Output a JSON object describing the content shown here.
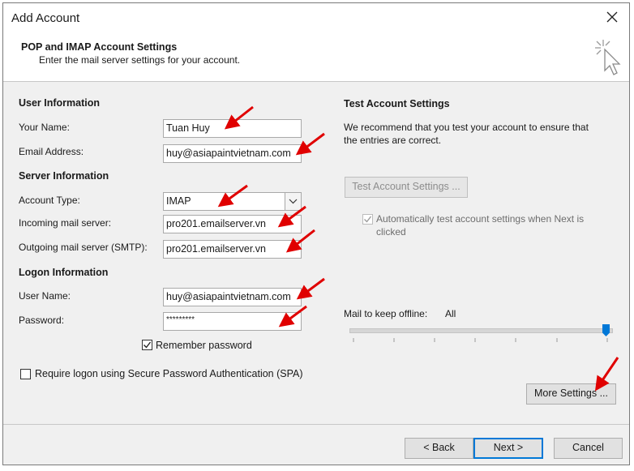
{
  "window": {
    "title": "Add Account"
  },
  "header": {
    "title": "POP and IMAP Account Settings",
    "subtitle": "Enter the mail server settings for your account."
  },
  "user_info": {
    "heading": "User Information",
    "name_label": "Your Name:",
    "name_value": "Tuan Huy",
    "email_label": "Email Address:",
    "email_value": "huy@asiapaintvietnam.com"
  },
  "server_info": {
    "heading": "Server Information",
    "type_label": "Account Type:",
    "type_value": "IMAP",
    "incoming_label": "Incoming mail server:",
    "incoming_value": "pro201.emailserver.vn",
    "outgoing_label": "Outgoing mail server (SMTP):",
    "outgoing_value": "pro201.emailserver.vn"
  },
  "logon_info": {
    "heading": "Logon Information",
    "user_label": "User Name:",
    "user_value": "huy@asiapaintvietnam.com",
    "password_label": "Password:",
    "password_value": "*********",
    "remember_label": "Remember password",
    "remember_checked": true,
    "spa_label": "Require logon using Secure Password Authentication (SPA)",
    "spa_checked": false
  },
  "test_settings": {
    "heading": "Test Account Settings",
    "description_line1": "We recommend that you test your account to ensure that",
    "description_line2": "the entries are correct.",
    "test_button": "Test Account Settings ...",
    "auto_test_line1": "Automatically test account settings when Next is",
    "auto_test_line2": "clicked",
    "auto_test_checked": true
  },
  "offline": {
    "label": "Mail to keep offline:",
    "value": "All",
    "slider_level": 1.0
  },
  "buttons": {
    "more_settings": "More Settings ...",
    "back": "< Back",
    "next": "Next >",
    "cancel": "Cancel"
  },
  "colors": {
    "accent": "#0078d7",
    "annotation_arrow": "#e00000"
  }
}
